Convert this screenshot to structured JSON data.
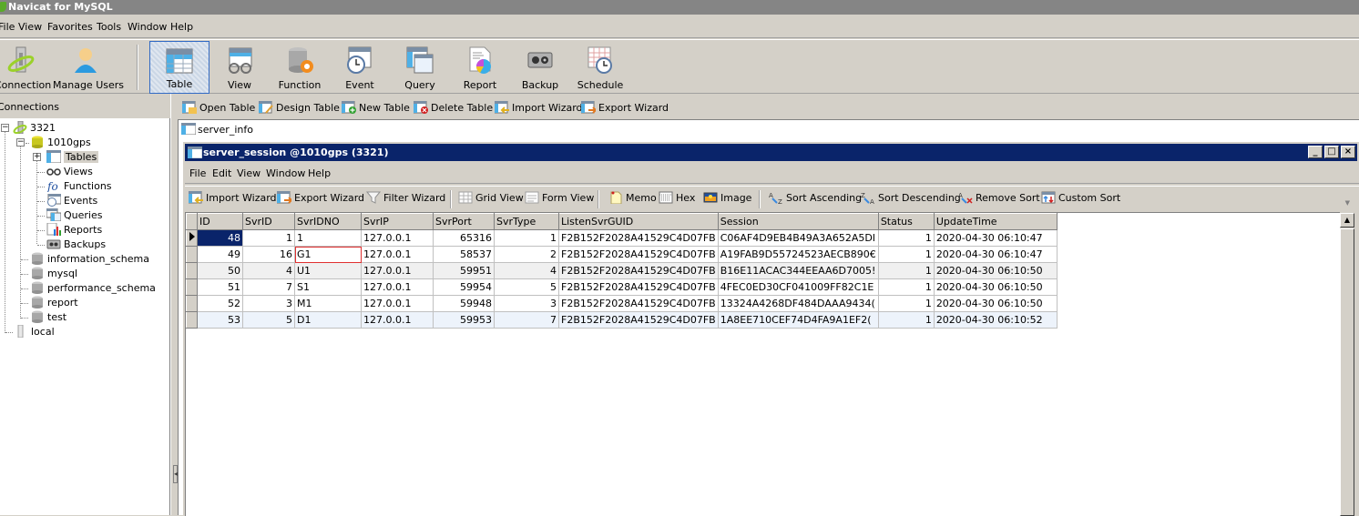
{
  "app": {
    "title": "Navicat for MySQL"
  },
  "menu": [
    "File",
    "View",
    "Favorites",
    "Tools",
    "Window",
    "Help"
  ],
  "main_toolbar": {
    "connection": "Connection",
    "manage_users": "Manage Users",
    "table": "Table",
    "view": "View",
    "function": "Function",
    "event": "Event",
    "query": "Query",
    "report": "Report",
    "backup": "Backup",
    "schedule": "Schedule",
    "active": "Table"
  },
  "connections": {
    "header": "Connections",
    "tree": {
      "conn1": "3321",
      "db_main": "1010gps",
      "nodes": [
        "Tables",
        "Views",
        "Functions",
        "Events",
        "Queries",
        "Reports",
        "Backups"
      ],
      "other_dbs": [
        "information_schema",
        "mysql",
        "performance_schema",
        "report",
        "test"
      ],
      "conn2": "local"
    }
  },
  "object_toolbar": [
    "Open Table",
    "Design Table",
    "New Table",
    "Delete Table",
    "Import Wizard",
    "Export Wizard"
  ],
  "object_list": {
    "items": [
      "server_info"
    ]
  },
  "child_window": {
    "title": "server_session @1010gps (3321)",
    "menu": [
      "File",
      "Edit",
      "View",
      "Window",
      "Help"
    ],
    "toolbar": {
      "import_wizard": "Import Wizard",
      "export_wizard": "Export Wizard",
      "filter_wizard": "Filter Wizard",
      "grid_view": "Grid View",
      "form_view": "Form View",
      "memo": "Memo",
      "hex": "Hex",
      "image": "Image",
      "sort_asc": "Sort Ascending",
      "sort_desc": "Sort Descending",
      "remove_sort": "Remove Sort",
      "custom_sort": "Custom Sort"
    },
    "grid": {
      "columns": [
        "ID",
        "SvrID",
        "SvrIDNO",
        "SvrIP",
        "SvrPort",
        "SvrType",
        "ListenSvrGUID",
        "Session",
        "Status",
        "UpdateTime"
      ],
      "rows": [
        [
          "48",
          "1",
          "1",
          "127.0.0.1",
          "65316",
          "1",
          "F2B152F2028A41529C4D07FB",
          "C06AF4D9EB4B49A3A652A5DI",
          "1",
          "2020-04-30 06:10:47"
        ],
        [
          "49",
          "16",
          "G1",
          "127.0.0.1",
          "58537",
          "2",
          "F2B152F2028A41529C4D07FB",
          "A19FAB9D55724523AECB890€",
          "1",
          "2020-04-30 06:10:47"
        ],
        [
          "50",
          "4",
          "U1",
          "127.0.0.1",
          "59951",
          "4",
          "F2B152F2028A41529C4D07FB",
          "B16E11ACAC344EEAA6D7005!",
          "1",
          "2020-04-30 06:10:50"
        ],
        [
          "51",
          "7",
          "S1",
          "127.0.0.1",
          "59954",
          "5",
          "F2B152F2028A41529C4D07FB",
          "4FEC0ED30CF041009FF82C1E",
          "1",
          "2020-04-30 06:10:50"
        ],
        [
          "52",
          "3",
          "M1",
          "127.0.0.1",
          "59948",
          "3",
          "F2B152F2028A41529C4D07FB",
          "13324A4268DF484DAAA9434(",
          "1",
          "2020-04-30 06:10:50"
        ],
        [
          "53",
          "5",
          "D1",
          "127.0.0.1",
          "59953",
          "7",
          "F2B152F2028A41529C4D07FB",
          "1A8EE710CEF74D4FA9A1EF2(",
          "1",
          "2020-04-30 06:10:52"
        ]
      ],
      "selected_row": 0,
      "focused_cell": {
        "row": 1,
        "col": "SvrIDNO"
      }
    }
  },
  "colors": {
    "title_active": "#0a246a",
    "face": "#d4d0c8",
    "selection": "#0a246a",
    "focus_border": "#e03030"
  }
}
